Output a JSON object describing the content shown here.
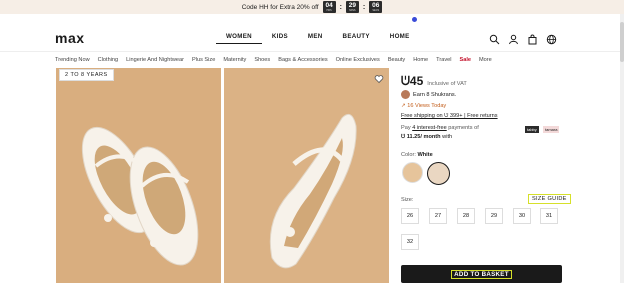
{
  "promo": {
    "text": "Code HH for Extra 20% off",
    "countdown": [
      {
        "value": "04",
        "unit": "HRS"
      },
      {
        "value": "29",
        "unit": "MINS"
      },
      {
        "value": "06",
        "unit": "SECS"
      }
    ]
  },
  "header": {
    "logo": "max",
    "nav": [
      "WOMEN",
      "KIDS",
      "MEN",
      "BEAUTY",
      "HOME"
    ],
    "active_nav": "WOMEN",
    "icons": [
      "search-icon",
      "user-icon",
      "bag-icon",
      "globe-icon"
    ]
  },
  "subnav": [
    "Trending Now",
    "Clothing",
    "Lingerie And Nightwear",
    "Plus Size",
    "Maternity",
    "Shoes",
    "Bags & Accessories",
    "Online Exclusives",
    "Beauty",
    "Home",
    "Travel",
    "Sale",
    "More"
  ],
  "gallery": {
    "age_badge": "2 TO 8 YEARS"
  },
  "product": {
    "currency_symbol": "ᕫ",
    "price": "45",
    "vat_note": "Inclusive of VAT",
    "earn_text": "Earn 8 Shukrans.",
    "views_text": "16 Views Today",
    "shipping_text": "Free shipping on ᕫ 399+ | Free returns",
    "pay_line1_prefix": "Pay",
    "pay_line1_link": "4 interest-free",
    "pay_line1_suffix": "payments of",
    "pay_line2": "ᕫ 11.25/ month",
    "pay_line2_suffix": "with",
    "tabby_label": "tabby",
    "tamara_label": "tamara",
    "color_label": "Color:",
    "color_value": "White",
    "size_label": "Size:",
    "size_guide": "SIZE GUIDE",
    "sizes": [
      "26",
      "27",
      "28",
      "29",
      "30",
      "31",
      "32"
    ],
    "add_to_basket": "ADD TO BASKET"
  },
  "colors": {
    "sale": "#c4102a",
    "views": "#c35d1a",
    "button": "#1a1a1a",
    "highlight": "#d6e02a"
  }
}
